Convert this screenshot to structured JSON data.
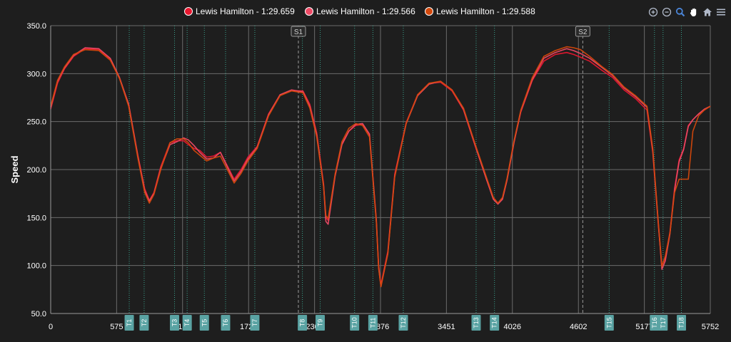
{
  "legend": [
    {
      "label": "Lewis Hamilton - 1:29.659",
      "color": "#e8172f"
    },
    {
      "label": "Lewis Hamilton - 1:29.566",
      "color": "#ee4a66"
    },
    {
      "label": "Lewis Hamilton - 1:29.588",
      "color": "#d4480c"
    }
  ],
  "toolbar": {
    "icons": [
      "zoom-in-icon",
      "zoom-out-icon",
      "zoom-select-icon",
      "pan-icon",
      "home-icon",
      "menu-icon"
    ],
    "accent": "#4a84d6"
  },
  "chart_data": {
    "type": "line",
    "title": "",
    "xlabel": "",
    "ylabel": "Speed",
    "xlim": [
      0,
      5752
    ],
    "ylim": [
      50,
      350
    ],
    "y_ticks": [
      "50.0",
      "100.0",
      "150.0",
      "200.0",
      "250.0",
      "300.0",
      "350.0"
    ],
    "x_ticks": [
      {
        "value": 0,
        "label": "0"
      },
      {
        "value": 575,
        "label": "575"
      },
      {
        "value": 1150,
        "label": "1150"
      },
      {
        "value": 1726,
        "label": "1726"
      },
      {
        "value": 2301,
        "label": "2301"
      },
      {
        "value": 2876,
        "label": "2876"
      },
      {
        "value": 3451,
        "label": "3451"
      },
      {
        "value": 4026,
        "label": "4026"
      },
      {
        "value": 4602,
        "label": "4602"
      },
      {
        "value": 5177,
        "label": "5177"
      },
      {
        "value": 5752,
        "label": "5752"
      }
    ],
    "grid": true,
    "sectors": [
      {
        "label": "S1",
        "x": 2160
      },
      {
        "label": "S2",
        "x": 4640
      }
    ],
    "turns": [
      {
        "label": "T1",
        "x": 685
      },
      {
        "label": "T2",
        "x": 815
      },
      {
        "label": "T3",
        "x": 1080
      },
      {
        "label": "T4",
        "x": 1190
      },
      {
        "label": "T5",
        "x": 1340
      },
      {
        "label": "T6",
        "x": 1525
      },
      {
        "label": "T7",
        "x": 1780
      },
      {
        "label": "T8",
        "x": 2195
      },
      {
        "label": "T9",
        "x": 2350
      },
      {
        "label": "T10",
        "x": 2650
      },
      {
        "label": "T11",
        "x": 2810
      },
      {
        "label": "T12",
        "x": 3075
      },
      {
        "label": "T13",
        "x": 3710
      },
      {
        "label": "T14",
        "x": 3870
      },
      {
        "label": "T15",
        "x": 4870
      },
      {
        "label": "T16",
        "x": 5265
      },
      {
        "label": "T17",
        "x": 5340
      },
      {
        "label": "T18",
        "x": 5500
      }
    ],
    "series": [
      {
        "name": "Lewis Hamilton - 1:29.659",
        "color": "#e8172f",
        "x": [
          0,
          60,
          120,
          200,
          300,
          420,
          520,
          600,
          680,
          760,
          820,
          860,
          900,
          960,
          1040,
          1100,
          1160,
          1200,
          1250,
          1300,
          1360,
          1420,
          1480,
          1540,
          1600,
          1660,
          1720,
          1800,
          1900,
          2000,
          2100,
          2200,
          2260,
          2320,
          2380,
          2400,
          2420,
          2480,
          2540,
          2600,
          2660,
          2720,
          2780,
          2840,
          2860,
          2880,
          2940,
          3000,
          3100,
          3200,
          3300,
          3400,
          3500,
          3600,
          3700,
          3800,
          3860,
          3900,
          3940,
          3980,
          4040,
          4100,
          4200,
          4300,
          4400,
          4500,
          4560,
          4620,
          4700,
          4800,
          4900,
          5000,
          5100,
          5200,
          5250,
          5300,
          5330,
          5360,
          5400,
          5440,
          5480,
          5520,
          5560,
          5600,
          5650,
          5700,
          5752
        ],
        "y": [
          263,
          290,
          305,
          318,
          326,
          325,
          315,
          295,
          268,
          215,
          180,
          168,
          176,
          203,
          228,
          230,
          230,
          226,
          222,
          220,
          213,
          214,
          218,
          204,
          190,
          200,
          213,
          224,
          258,
          278,
          282,
          282,
          268,
          238,
          185,
          150,
          147,
          195,
          227,
          240,
          246,
          247,
          236,
          148,
          100,
          80,
          115,
          195,
          249,
          278,
          290,
          291,
          282,
          262,
          225,
          190,
          170,
          165,
          170,
          190,
          229,
          260,
          293,
          313,
          320,
          322,
          320,
          317,
          313,
          304,
          296,
          283,
          274,
          262,
          218,
          140,
          100,
          108,
          135,
          180,
          210,
          222,
          246,
          252,
          258,
          262,
          266
        ]
      },
      {
        "name": "Lewis Hamilton - 1:29.566",
        "color": "#ee4a66",
        "x": [
          0,
          60,
          120,
          200,
          300,
          420,
          520,
          600,
          680,
          760,
          820,
          860,
          900,
          960,
          1040,
          1100,
          1160,
          1200,
          1250,
          1300,
          1360,
          1420,
          1480,
          1540,
          1600,
          1660,
          1720,
          1800,
          1900,
          2000,
          2100,
          2200,
          2260,
          2320,
          2380,
          2400,
          2420,
          2480,
          2540,
          2600,
          2660,
          2720,
          2780,
          2840,
          2860,
          2880,
          2940,
          3000,
          3100,
          3200,
          3300,
          3400,
          3500,
          3600,
          3700,
          3800,
          3860,
          3900,
          3940,
          3980,
          4040,
          4100,
          4200,
          4300,
          4400,
          4500,
          4560,
          4620,
          4700,
          4800,
          4900,
          5000,
          5100,
          5200,
          5250,
          5300,
          5330,
          5360,
          5400,
          5440,
          5480,
          5520,
          5560,
          5600,
          5650,
          5700,
          5752
        ],
        "y": [
          265,
          292,
          306,
          319,
          327,
          326,
          316,
          296,
          268,
          214,
          178,
          167,
          175,
          201,
          226,
          229,
          233,
          231,
          225,
          218,
          211,
          212,
          218,
          203,
          188,
          198,
          211,
          223,
          257,
          278,
          283,
          281,
          266,
          236,
          183,
          146,
          143,
          193,
          226,
          240,
          247,
          248,
          237,
          146,
          98,
          78,
          113,
          193,
          248,
          277,
          289,
          292,
          283,
          263,
          226,
          190,
          169,
          164,
          169,
          189,
          228,
          261,
          294,
          316,
          322,
          326,
          324,
          321,
          316,
          307,
          298,
          285,
          276,
          265,
          220,
          142,
          96,
          105,
          133,
          178,
          208,
          221,
          245,
          252,
          258,
          263,
          266
        ]
      },
      {
        "name": "Lewis Hamilton - 1:29.588",
        "color": "#d4480c",
        "x": [
          0,
          60,
          120,
          200,
          300,
          420,
          520,
          600,
          680,
          760,
          820,
          860,
          900,
          960,
          1040,
          1100,
          1160,
          1200,
          1250,
          1300,
          1360,
          1420,
          1480,
          1540,
          1600,
          1660,
          1720,
          1800,
          1900,
          2000,
          2100,
          2200,
          2260,
          2320,
          2380,
          2400,
          2420,
          2480,
          2540,
          2600,
          2660,
          2720,
          2780,
          2840,
          2860,
          2880,
          2940,
          3000,
          3100,
          3200,
          3300,
          3400,
          3500,
          3600,
          3700,
          3800,
          3860,
          3900,
          3940,
          3980,
          4040,
          4100,
          4200,
          4300,
          4400,
          4500,
          4560,
          4620,
          4700,
          4800,
          4900,
          5000,
          5100,
          5200,
          5250,
          5300,
          5330,
          5360,
          5400,
          5440,
          5480,
          5520,
          5560,
          5600,
          5650,
          5700,
          5752
        ],
        "y": [
          266,
          293,
          307,
          320,
          325,
          324,
          314,
          295,
          266,
          212,
          176,
          165,
          174,
          200,
          228,
          232,
          232,
          228,
          220,
          215,
          209,
          212,
          214,
          200,
          186,
          196,
          209,
          222,
          256,
          277,
          282,
          280,
          264,
          234,
          182,
          152,
          149,
          195,
          229,
          243,
          248,
          246,
          234,
          145,
          97,
          78,
          112,
          192,
          248,
          278,
          290,
          292,
          283,
          264,
          227,
          192,
          171,
          165,
          171,
          191,
          230,
          262,
          296,
          318,
          324,
          328,
          327,
          325,
          318,
          308,
          299,
          286,
          277,
          266,
          222,
          143,
          99,
          110,
          134,
          176,
          190,
          190,
          190,
          240,
          256,
          262,
          266
        ]
      }
    ]
  }
}
